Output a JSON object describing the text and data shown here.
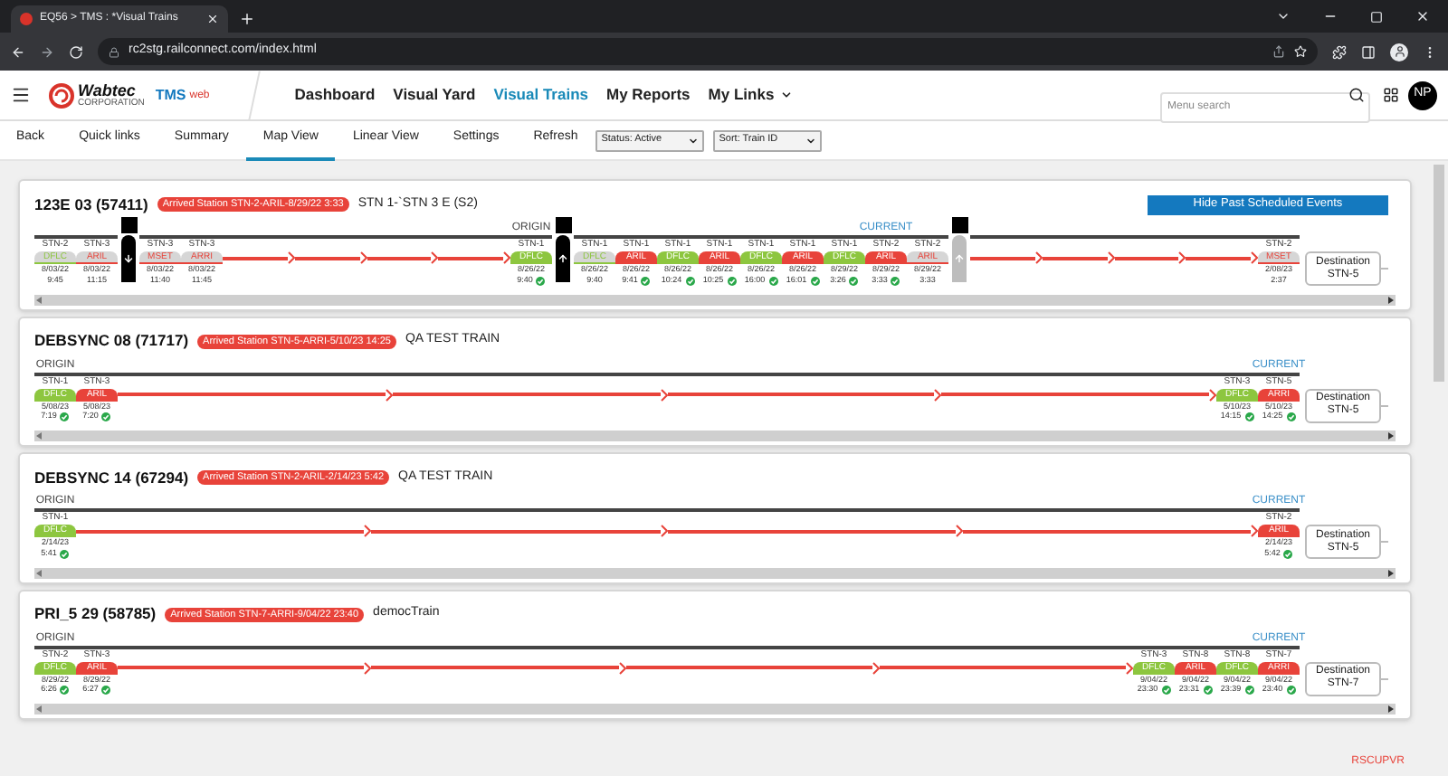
{
  "browser": {
    "tab_title": "EQ56 > TMS : *Visual Trains",
    "url": "rc2stg.railconnect.com/index.html"
  },
  "header": {
    "logo": "Wabtec",
    "logo_sub": "CORPORATION",
    "product": "TMS",
    "product_sub": "web",
    "nav": [
      {
        "label": "Dashboard",
        "selected": false,
        "menu": false
      },
      {
        "label": "Visual Yard",
        "selected": false,
        "menu": false
      },
      {
        "label": "Visual Trains",
        "selected": true,
        "menu": false
      },
      {
        "label": "My Reports",
        "selected": false,
        "menu": false
      },
      {
        "label": "My Links",
        "selected": false,
        "menu": true
      }
    ],
    "search": {
      "placeholder": "Menu search"
    },
    "avatar": "NP"
  },
  "subnav": [
    {
      "label": "Back",
      "selected": false
    },
    {
      "label": "Quick links",
      "selected": false
    },
    {
      "label": "Summary",
      "selected": false
    },
    {
      "label": "Map View",
      "selected": true
    },
    {
      "label": "Linear View",
      "selected": false
    },
    {
      "label": "Settings",
      "selected": false
    },
    {
      "label": "Refresh",
      "selected": false
    }
  ],
  "filters": [
    {
      "value": "Status: Active"
    },
    {
      "value": "Sort: Train ID"
    }
  ],
  "trains": [
    {
      "title": "123E 03 (57411)",
      "status": "Arrived Station STN-2-ARIL-8/29/22 3:33",
      "description": "STN 1-`STN 3 E (S2)",
      "button": "Hide Past Scheduled Events",
      "destination": {
        "label": "Destination",
        "station": "STN-5"
      },
      "events": [
        {
          "kind": "stop",
          "station": "STN-2",
          "code": "DFLC",
          "date": "8/03/22",
          "time": "9:45",
          "color": "#8dc63f",
          "faded": true,
          "checked": false
        },
        {
          "kind": "stop",
          "station": "STN-3",
          "code": "ARIL",
          "date": "8/03/22",
          "time": "11:15",
          "color": "#e8433a",
          "faded": true,
          "checked": false
        },
        {
          "kind": "marker",
          "pointing_up": false,
          "faded": false
        },
        {
          "kind": "stop",
          "station": "STN-3",
          "code": "MSET",
          "date": "8/03/22",
          "time": "11:40",
          "color": "#e8433a",
          "faded": true,
          "checked": false
        },
        {
          "kind": "stop",
          "station": "STN-3",
          "code": "ARRI",
          "date": "8/03/22",
          "time": "11:45",
          "color": "#e8433a",
          "faded": true,
          "checked": false
        },
        {
          "kind": "gap"
        },
        {
          "kind": "stop",
          "station": "STN-1",
          "code": "DFLC",
          "date": "8/26/22",
          "time": "9:40",
          "color": "#8dc63f",
          "faded": false,
          "checked": true,
          "tag": {
            "text": "ORIGIN",
            "kind": "origin"
          }
        },
        {
          "kind": "marker",
          "pointing_up": true,
          "faded": false
        },
        {
          "kind": "stop",
          "station": "STN-1",
          "code": "DFLC",
          "date": "8/26/22",
          "time": "9:40",
          "color": "#8dc63f",
          "faded": true,
          "checked": false
        },
        {
          "kind": "stop",
          "station": "STN-1",
          "code": "ARIL",
          "date": "8/26/22",
          "time": "9:41",
          "color": "#e8433a",
          "faded": false,
          "checked": true
        },
        {
          "kind": "stop",
          "station": "STN-1",
          "code": "DFLC",
          "date": "8/26/22",
          "time": "10:24",
          "color": "#8dc63f",
          "faded": false,
          "checked": true
        },
        {
          "kind": "stop",
          "station": "STN-1",
          "code": "ARIL",
          "date": "8/26/22",
          "time": "10:25",
          "color": "#e8433a",
          "faded": false,
          "checked": true
        },
        {
          "kind": "stop",
          "station": "STN-1",
          "code": "DFLC",
          "date": "8/26/22",
          "time": "16:00",
          "color": "#8dc63f",
          "faded": false,
          "checked": true
        },
        {
          "kind": "stop",
          "station": "STN-1",
          "code": "ARIL",
          "date": "8/26/22",
          "time": "16:01",
          "color": "#e8433a",
          "faded": false,
          "checked": true
        },
        {
          "kind": "stop",
          "station": "STN-1",
          "code": "DFLC",
          "date": "8/29/22",
          "time": "3:26",
          "color": "#8dc63f",
          "faded": false,
          "checked": true
        },
        {
          "kind": "stop",
          "station": "STN-2",
          "code": "ARIL",
          "date": "8/29/22",
          "time": "3:33",
          "color": "#e8433a",
          "faded": false,
          "checked": true,
          "tag": {
            "text": "CURRENT",
            "kind": "current"
          }
        },
        {
          "kind": "stop",
          "station": "STN-2",
          "code": "ARIL",
          "date": "8/29/22",
          "time": "3:33",
          "color": "#e8433a",
          "faded": true,
          "checked": false
        },
        {
          "kind": "marker",
          "pointing_up": true,
          "faded": true
        },
        {
          "kind": "gap"
        },
        {
          "kind": "stop",
          "station": "STN-2",
          "code": "MSET",
          "date": "2/08/23",
          "time": "2:37",
          "color": "#e8433a",
          "faded": true,
          "checked": false
        }
      ]
    },
    {
      "title": "DEBSYNC 08 (71717)",
      "status": "Arrived Station STN-5-ARRI-5/10/23 14:25",
      "description": "QA TEST TRAIN",
      "destination": {
        "label": "Destination",
        "station": "STN-5"
      },
      "events": [
        {
          "kind": "stop",
          "station": "STN-1",
          "code": "DFLC",
          "date": "5/08/23",
          "time": "7:19",
          "color": "#8dc63f",
          "faded": false,
          "checked": true,
          "tag": {
            "text": "ORIGIN",
            "kind": "origin"
          }
        },
        {
          "kind": "stop",
          "station": "STN-3",
          "code": "ARIL",
          "date": "5/08/23",
          "time": "7:20",
          "color": "#e8433a",
          "faded": false,
          "checked": true
        },
        {
          "kind": "gap"
        },
        {
          "kind": "stop",
          "station": "STN-3",
          "code": "DFLC",
          "date": "5/10/23",
          "time": "14:15",
          "color": "#8dc63f",
          "faded": false,
          "checked": true
        },
        {
          "kind": "stop",
          "station": "STN-5",
          "code": "ARRI",
          "date": "5/10/23",
          "time": "14:25",
          "color": "#e8433a",
          "faded": false,
          "checked": true,
          "tag": {
            "text": "CURRENT",
            "kind": "current"
          }
        }
      ]
    },
    {
      "title": "DEBSYNC 14 (67294)",
      "status": "Arrived Station STN-2-ARIL-2/14/23 5:42",
      "description": "QA TEST TRAIN",
      "destination": {
        "label": "Destination",
        "station": "STN-5"
      },
      "events": [
        {
          "kind": "stop",
          "station": "STN-1",
          "code": "DFLC",
          "date": "2/14/23",
          "time": "5:41",
          "color": "#8dc63f",
          "faded": false,
          "checked": true,
          "tag": {
            "text": "ORIGIN",
            "kind": "origin"
          }
        },
        {
          "kind": "gap"
        },
        {
          "kind": "stop",
          "station": "STN-2",
          "code": "ARIL",
          "date": "2/14/23",
          "time": "5:42",
          "color": "#e8433a",
          "faded": false,
          "checked": true,
          "tag": {
            "text": "CURRENT",
            "kind": "current"
          }
        }
      ]
    },
    {
      "title": "PRI_5 29 (58785)",
      "status": "Arrived Station STN-7-ARRI-9/04/22 23:40",
      "description": "democTrain",
      "destination": {
        "label": "Destination",
        "station": "STN-7"
      },
      "events": [
        {
          "kind": "stop",
          "station": "STN-2",
          "code": "DFLC",
          "date": "8/29/22",
          "time": "6:26",
          "color": "#8dc63f",
          "faded": false,
          "checked": true,
          "tag": {
            "text": "ORIGIN",
            "kind": "origin"
          }
        },
        {
          "kind": "stop",
          "station": "STN-3",
          "code": "ARIL",
          "date": "8/29/22",
          "time": "6:27",
          "color": "#e8433a",
          "faded": false,
          "checked": true
        },
        {
          "kind": "gap"
        },
        {
          "kind": "stop",
          "station": "STN-3",
          "code": "DFLC",
          "date": "9/04/22",
          "time": "23:30",
          "color": "#8dc63f",
          "faded": false,
          "checked": true
        },
        {
          "kind": "stop",
          "station": "STN-8",
          "code": "ARIL",
          "date": "9/04/22",
          "time": "23:31",
          "color": "#e8433a",
          "faded": false,
          "checked": true
        },
        {
          "kind": "stop",
          "station": "STN-8",
          "code": "DFLC",
          "date": "9/04/22",
          "time": "23:39",
          "color": "#8dc63f",
          "faded": false,
          "checked": true
        },
        {
          "kind": "stop",
          "station": "STN-7",
          "code": "ARRI",
          "date": "9/04/22",
          "time": "23:40",
          "color": "#e8433a",
          "faded": false,
          "checked": true,
          "tag": {
            "text": "CURRENT",
            "kind": "current"
          }
        }
      ]
    }
  ],
  "user_code": "RSCUPVR"
}
